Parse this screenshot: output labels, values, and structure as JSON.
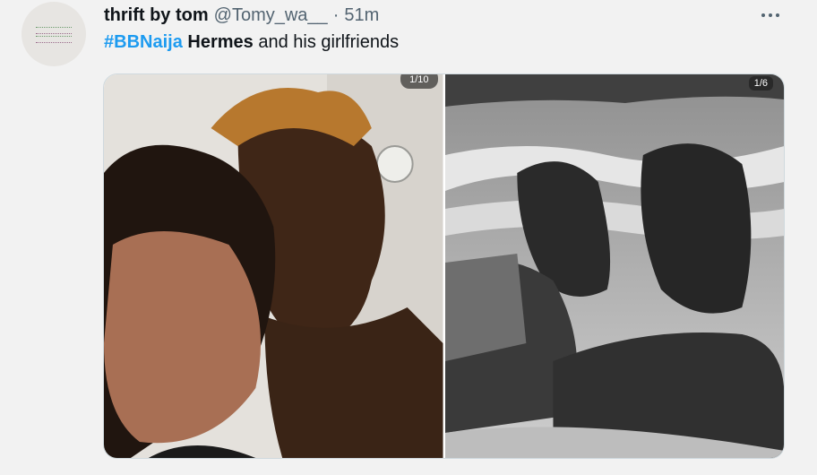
{
  "tweet": {
    "display_name": "thrift by tom",
    "handle": "@Tomy_wa__",
    "separator": "·",
    "time": "51m",
    "hashtag": "#BBNaija",
    "bold_word": "Hermes",
    "rest_text": " and his girlfriends"
  },
  "avatar": {
    "icon": "brand-logo-icon"
  },
  "media": {
    "left_counter": "1/10",
    "right_counter": "1/6"
  },
  "colors": {
    "link": "#1d9bf0",
    "muted": "#536471",
    "text": "#0f1419"
  }
}
